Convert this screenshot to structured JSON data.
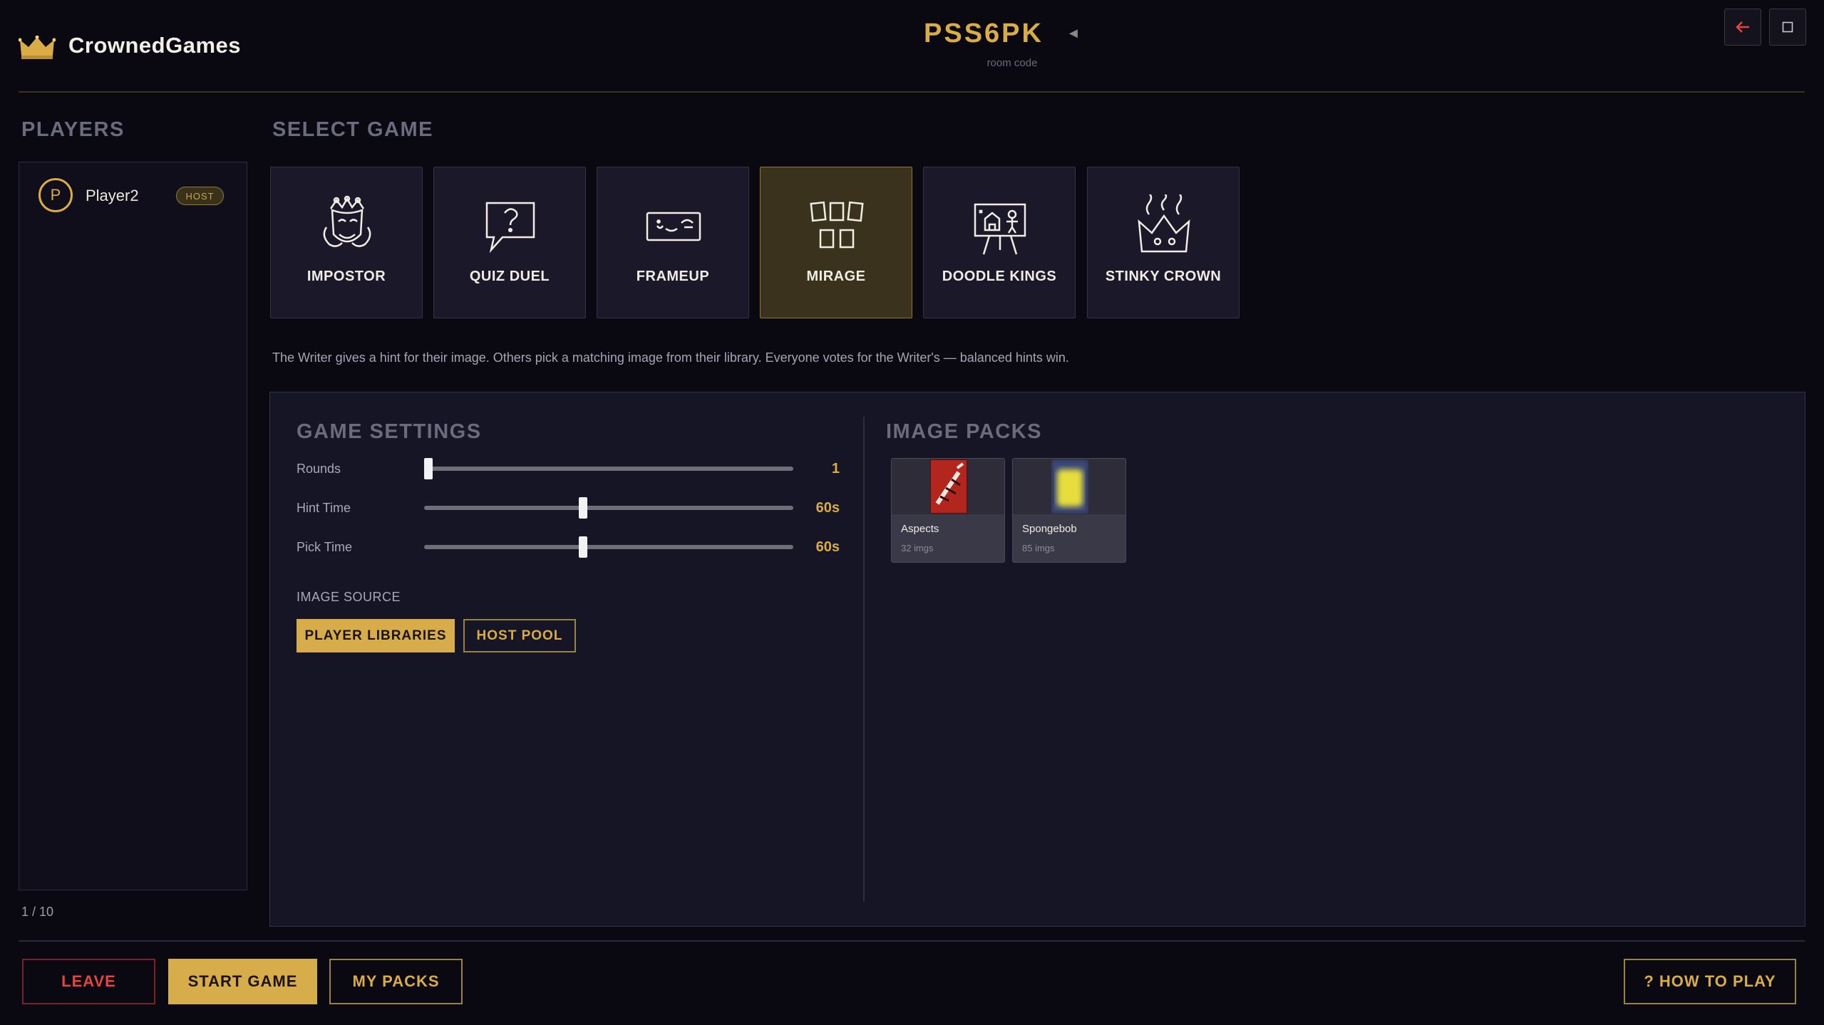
{
  "header": {
    "brand": "CrownedGames",
    "room_code": "PSS6PK",
    "room_label": "room code",
    "room_arrow": "◄",
    "back_icon": "arrow-left-icon",
    "square_icon": "square-icon"
  },
  "players": {
    "heading": "PLAYERS",
    "list": [
      {
        "initial": "P",
        "name": "Player2",
        "badge": "HOST"
      }
    ],
    "count": "1 / 10"
  },
  "games": {
    "heading": "SELECT GAME",
    "items": [
      {
        "label": "IMPOSTOR",
        "icon": "jester-mask-icon",
        "selected": false
      },
      {
        "label": "QUIZ DUEL",
        "icon": "question-bubble-icon",
        "selected": false
      },
      {
        "label": "FRAMEUP",
        "icon": "frame-icon",
        "selected": false
      },
      {
        "label": "MIRAGE",
        "icon": "cards-icon",
        "selected": true
      },
      {
        "label": "DOODLE KINGS",
        "icon": "easel-icon",
        "selected": false
      },
      {
        "label": "STINKY CROWN",
        "icon": "stinky-crown-icon",
        "selected": false
      }
    ],
    "description": "The Writer gives a hint for their image. Others pick a matching image from their library. Everyone votes for the Writer's — balanced hints win."
  },
  "settings": {
    "heading": "GAME SETTINGS",
    "sliders": [
      {
        "label": "Rounds",
        "value": "1",
        "level": 0.0
      },
      {
        "label": "Hint Time",
        "value": "60s",
        "level": 0.43
      },
      {
        "label": "Pick Time",
        "value": "60s",
        "level": 0.43
      }
    ],
    "image_source_label": "IMAGE SOURCE",
    "source_options": [
      {
        "label": "PLAYER LIBRARIES",
        "active": true
      },
      {
        "label": "HOST POOL",
        "active": false
      }
    ]
  },
  "image_packs": {
    "heading": "IMAGE PACKS",
    "packs": [
      {
        "name": "Aspects",
        "count": "32 imgs"
      },
      {
        "name": "Spongebob",
        "count": "85 imgs"
      }
    ]
  },
  "footer": {
    "leave": "LEAVE",
    "start": "START GAME",
    "my_packs": "MY PACKS",
    "how_to_play": "? HOW TO PLAY"
  },
  "colors": {
    "accent": "#d9ac45",
    "danger": "#e5453f",
    "background": "#0a0912",
    "panel": "#161526"
  }
}
